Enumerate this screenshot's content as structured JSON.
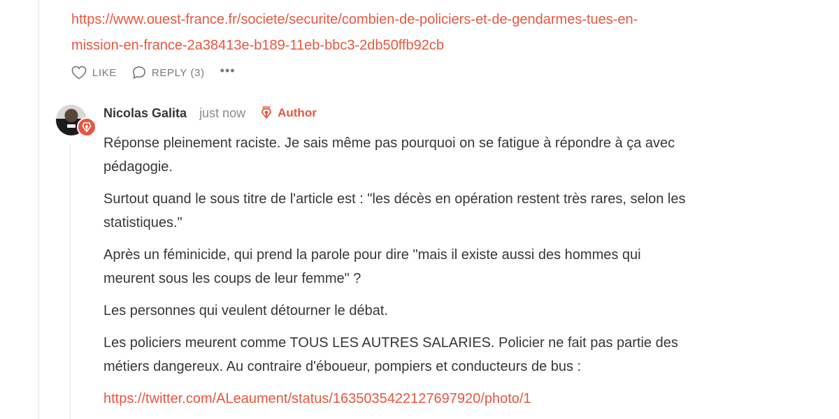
{
  "top_link": {
    "line1": "https://www.ouest-france.fr/societe/securite/combien-de-policiers-et-de-gendarmes-tues-en-",
    "line2": "mission-en-france-2a38413e-b189-11eb-bbc3-2db50ffb92cb"
  },
  "actions": {
    "like_label": "LIKE",
    "reply_label": "REPLY (3)",
    "more_label": "•••"
  },
  "comment": {
    "author_name": "Nicolas Galita",
    "time": "just now",
    "author_tag": "Author",
    "paragraphs": [
      [
        "Réponse pleinement raciste. Je sais même pas pourquoi on se fatigue à répondre à ça avec",
        "pédagogie."
      ],
      [
        "Surtout quand le sous titre de l'article est : \"les décès en opération restent très rares, selon les",
        "statistiques.\""
      ],
      [
        "Après un féminicide, qui prend la parole pour dire \"mais il existe aussi des hommes qui",
        "meurent sous les coups de leur femme\" ?"
      ],
      [
        "Les personnes qui veulent détourner le débat."
      ],
      [
        "Les policiers meurent comme TOUS LES AUTRES SALARIES. Policier ne fait pas partie des",
        "métiers dangereux. Au contraire d'éboueur, pompiers et conducteurs de bus :"
      ]
    ],
    "link": "https://twitter.com/ALeaument/status/1635035422127697920/photo/1"
  },
  "colors": {
    "accent": "#e8563f",
    "text": "#363737",
    "muted": "#7a7a7a",
    "thread_line": "#e6e6e6"
  },
  "icons": {
    "like": "heart-outline-icon",
    "reply": "speech-bubble-icon",
    "more": "ellipsis-icon",
    "author": "fountain-pen-nib-icon"
  }
}
